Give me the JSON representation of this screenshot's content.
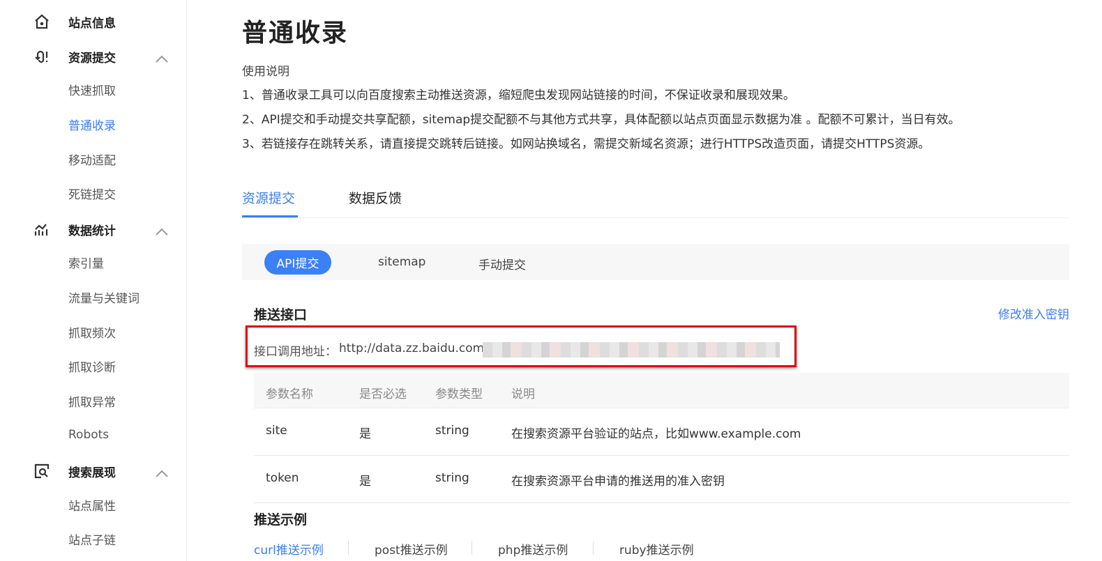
{
  "sidebar": {
    "items": [
      {
        "label": "站点信息",
        "type": "group",
        "icon": "home-icon"
      },
      {
        "label": "资源提交",
        "type": "group",
        "icon": "submit-icon"
      },
      {
        "label": "快速抓取"
      },
      {
        "label": "普通收录",
        "active": true
      },
      {
        "label": "移动适配"
      },
      {
        "label": "死链提交"
      },
      {
        "label": "数据统计",
        "type": "group",
        "icon": "chart-icon"
      },
      {
        "label": "索引量"
      },
      {
        "label": "流量与关键词"
      },
      {
        "label": "抓取频次"
      },
      {
        "label": "抓取诊断"
      },
      {
        "label": "抓取异常"
      },
      {
        "label": "Robots"
      },
      {
        "label": "搜索展现",
        "type": "group",
        "icon": "search-display-icon"
      },
      {
        "label": "站点属性"
      },
      {
        "label": "站点子链"
      }
    ]
  },
  "main": {
    "title": "普通收录",
    "usage_title": "使用说明",
    "usage": [
      "1、普通收录工具可以向百度搜索主动推送资源，缩短爬虫发现网站链接的时间，不保证收录和展现效果。",
      "2、API提交和手动提交共享配额，sitemap提交配额不与其他方式共享，具体配额以站点页面显示数据为准 。配额不可累计，当日有效。",
      "3、若链接存在跳转关系，请直接提交跳转后链接。如网站换域名，需提交新域名资源；进行HTTPS改造页面，请提交HTTPS资源。"
    ],
    "tabs": [
      "资源提交",
      "数据反馈"
    ],
    "subtabs": [
      "API提交",
      "sitemap",
      "手动提交"
    ],
    "push_title": "推送接口",
    "modify_key": "修改准入密钥",
    "api_address_label": "接口调用地址：",
    "api_address": "http://data.zz.baidu.com/",
    "table": {
      "headers": [
        "参数名称",
        "是否必选",
        "参数类型",
        "说明"
      ],
      "rows": [
        [
          "site",
          "是",
          "string",
          "在搜索资源平台验证的站点，比如www.example.com"
        ],
        [
          "token",
          "是",
          "string",
          "在搜索资源平台申请的推送用的准入密钥"
        ]
      ]
    },
    "example_title": "推送示例",
    "examples": [
      "curl推送示例",
      "post推送示例",
      "php推送示例",
      "ruby推送示例"
    ]
  },
  "colors": {
    "accent": "#3c80f6",
    "highlight": "#e30000"
  }
}
